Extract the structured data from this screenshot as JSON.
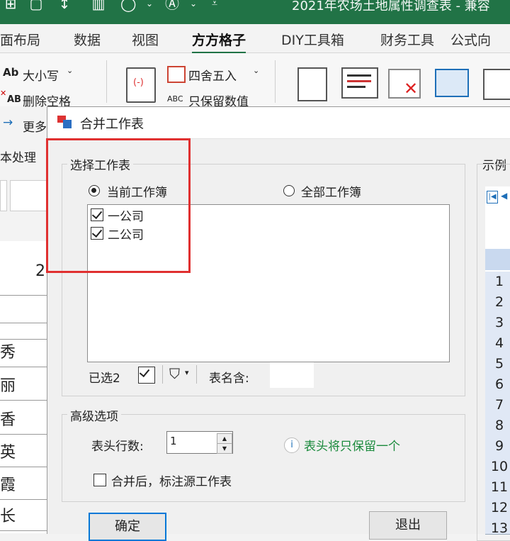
{
  "app": {
    "window_title": "2021年农场土地属性调查表 - 兼容",
    "accent_color": "#217346"
  },
  "quick_access": [
    "grid-icon",
    "file-icon",
    "sort-az-icon",
    "chart-icon",
    "shapes-icon",
    "text-a-icon"
  ],
  "tabs": [
    {
      "label": "面布局",
      "active": false
    },
    {
      "label": "数据",
      "active": false
    },
    {
      "label": "视图",
      "active": false
    },
    {
      "label": "方方格子",
      "active": true
    },
    {
      "label": "DIY工具箱",
      "active": false
    },
    {
      "label": "财务工具",
      "active": false
    },
    {
      "label": "公式向",
      "active": false
    }
  ],
  "ribbon": {
    "case_label": "大小写",
    "case_prefix": "Ab",
    "remove_space_label": "删除空格",
    "remove_space_prefix": "AB",
    "more_label": "更多",
    "more_prefix": "→",
    "round_label": "四舍五入",
    "keep_value_label": "只保留数值",
    "keep_value_prefix": "ABC",
    "group_label": "本处理"
  },
  "sheet": {
    "cells": [
      "2",
      "",
      "秀",
      "丽",
      "香",
      "英",
      "霞",
      "长"
    ]
  },
  "dialog": {
    "title": "合并工作表",
    "select_group_label": "选择工作表",
    "radio_current": "当前工作簿",
    "radio_all": "全部工作簿",
    "sheets": [
      {
        "name": "一公司",
        "checked": true
      },
      {
        "name": "二公司",
        "checked": true
      }
    ],
    "selected_count_label": "已选2",
    "name_contains_label": "表名含:",
    "name_contains_value": "",
    "advanced_group_label": "高级选项",
    "header_rows_label": "表头行数:",
    "header_rows_value": "1",
    "info_text": "表头将只保留一个",
    "mark_source_label": "合并后，标注源工作表",
    "mark_source_checked": false,
    "ok_label": "确定",
    "exit_label": "退出",
    "preview_label": "示例",
    "preview_rows": [
      "1",
      "2",
      "3",
      "4",
      "5",
      "6",
      "7",
      "8",
      "9",
      "10",
      "11",
      "12",
      "13"
    ]
  }
}
